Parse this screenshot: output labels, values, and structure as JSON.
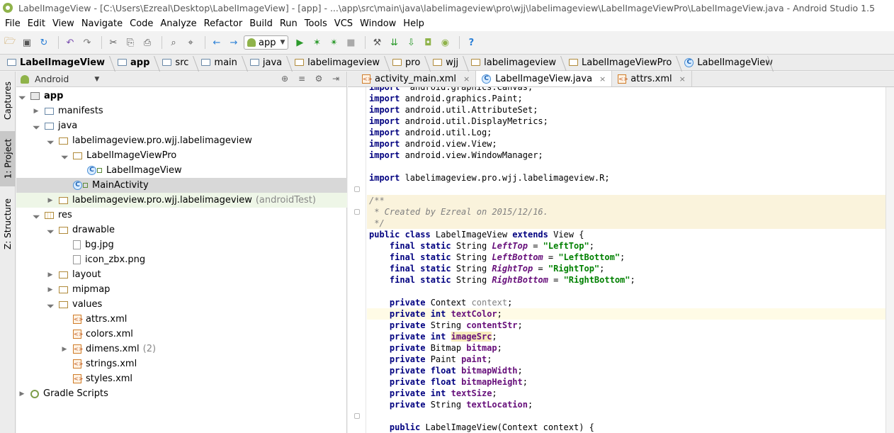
{
  "window": {
    "title": "LabelImageView - [C:\\Users\\Ezreal\\Desktop\\LabelImageView] - [app] - ...\\app\\src\\main\\java\\labelimageview\\pro\\wjj\\labelimageview\\LabelImageViewPro\\LabelImageView.java - Android Studio 1.5"
  },
  "menu": [
    "File",
    "Edit",
    "View",
    "Navigate",
    "Code",
    "Analyze",
    "Refactor",
    "Build",
    "Run",
    "Tools",
    "VCS",
    "Window",
    "Help"
  ],
  "toolbar": {
    "run_config": "app",
    "icons": [
      "open-icon",
      "save-icon",
      "sync-icon",
      "undo-icon",
      "redo-icon",
      "cut-icon",
      "copy-icon",
      "paste-icon",
      "find-icon",
      "replace-icon",
      "back-icon",
      "forward-icon",
      "run-icon",
      "debug-icon",
      "attach-icon",
      "stop-icon",
      "sdk-icon",
      "sync-gradle-icon",
      "avd-icon",
      "monitor-icon",
      "help-icon"
    ]
  },
  "breadcrumb": [
    "LabelImageView",
    "app",
    "src",
    "main",
    "java",
    "labelimageview",
    "pro",
    "wjj",
    "labelimageview",
    "LabelImageViewPro",
    "LabelImageView"
  ],
  "left_strip": {
    "captures": "Captures",
    "project": "1: Project",
    "structure": "Z: Structure"
  },
  "project_panel": {
    "view_selector": "Android",
    "tree": [
      {
        "label": "app",
        "extra": "",
        "depth": 0,
        "expanded": true,
        "icon": "module-icon",
        "bold": true
      },
      {
        "label": "manifests",
        "extra": "",
        "depth": 1,
        "expanded": false,
        "icon": "folder-icon"
      },
      {
        "label": "java",
        "extra": "",
        "depth": 1,
        "expanded": true,
        "icon": "folder-icon"
      },
      {
        "label": "labelimageview.pro.wjj.labelimageview",
        "extra": "",
        "depth": 2,
        "expanded": true,
        "icon": "package-icon"
      },
      {
        "label": "LabelImageViewPro",
        "extra": "",
        "depth": 3,
        "expanded": true,
        "icon": "package-icon"
      },
      {
        "label": "LabelImageView",
        "extra": "",
        "depth": 4,
        "expanded": null,
        "icon": "class-icon"
      },
      {
        "label": "MainActivity",
        "extra": "",
        "depth": 3,
        "expanded": null,
        "icon": "class-icon",
        "selected": true
      },
      {
        "label": "labelimageview.pro.wjj.labelimageview",
        "extra": "(androidTest)",
        "depth": 2,
        "expanded": false,
        "icon": "package-icon",
        "tinted": true
      },
      {
        "label": "res",
        "extra": "",
        "depth": 1,
        "expanded": true,
        "icon": "res-folder-icon"
      },
      {
        "label": "drawable",
        "extra": "",
        "depth": 2,
        "expanded": true,
        "icon": "package-icon"
      },
      {
        "label": "bg.jpg",
        "extra": "",
        "depth": 3,
        "expanded": null,
        "icon": "image-file-icon"
      },
      {
        "label": "icon_zbx.png",
        "extra": "",
        "depth": 3,
        "expanded": null,
        "icon": "image-file-icon"
      },
      {
        "label": "layout",
        "extra": "",
        "depth": 2,
        "expanded": false,
        "icon": "package-icon"
      },
      {
        "label": "mipmap",
        "extra": "",
        "depth": 2,
        "expanded": false,
        "icon": "package-icon"
      },
      {
        "label": "values",
        "extra": "",
        "depth": 2,
        "expanded": true,
        "icon": "package-icon"
      },
      {
        "label": "attrs.xml",
        "extra": "",
        "depth": 3,
        "expanded": null,
        "icon": "xml-file-icon"
      },
      {
        "label": "colors.xml",
        "extra": "",
        "depth": 3,
        "expanded": null,
        "icon": "xml-file-icon"
      },
      {
        "label": "dimens.xml",
        "extra": "(2)",
        "depth": 3,
        "expanded": false,
        "icon": "xml-file-icon"
      },
      {
        "label": "strings.xml",
        "extra": "",
        "depth": 3,
        "expanded": null,
        "icon": "xml-file-icon"
      },
      {
        "label": "styles.xml",
        "extra": "",
        "depth": 3,
        "expanded": null,
        "icon": "xml-file-icon"
      },
      {
        "label": "Gradle Scripts",
        "extra": "",
        "depth": 0,
        "expanded": false,
        "icon": "gradle-icon"
      }
    ]
  },
  "editor": {
    "tabs": [
      {
        "label": "activity_main.xml",
        "active": false
      },
      {
        "label": "LabelImageView.java",
        "active": true
      },
      {
        "label": "attrs.xml",
        "active": false
      }
    ],
    "lines": [
      {
        "segs": [
          [
            "kw",
            "import"
          ],
          [
            "",
            "  android.graphics.Canvas;"
          ]
        ],
        "clip": true
      },
      {
        "segs": [
          [
            "kw",
            "import"
          ],
          [
            "",
            " android.graphics.Paint;"
          ]
        ]
      },
      {
        "segs": [
          [
            "kw",
            "import"
          ],
          [
            "",
            " android.util.AttributeSet;"
          ]
        ]
      },
      {
        "segs": [
          [
            "kw",
            "import"
          ],
          [
            "",
            " android.util.DisplayMetrics;"
          ]
        ]
      },
      {
        "segs": [
          [
            "kw",
            "import"
          ],
          [
            "",
            " android.util.Log;"
          ]
        ]
      },
      {
        "segs": [
          [
            "kw",
            "import"
          ],
          [
            "",
            " android.view.View;"
          ]
        ]
      },
      {
        "segs": [
          [
            "kw",
            "import"
          ],
          [
            "",
            " android.view.WindowManager;"
          ]
        ]
      },
      {
        "segs": []
      },
      {
        "segs": [
          [
            "kw",
            "import"
          ],
          [
            "",
            " labelimageview.pro.wjj.labelimageview.R;"
          ]
        ]
      },
      {
        "segs": []
      },
      {
        "segs": [
          [
            "cm",
            "/**"
          ]
        ],
        "doc": true
      },
      {
        "segs": [
          [
            "cm",
            " * Created by Ezreal on 2015/12/16."
          ]
        ],
        "doc": true
      },
      {
        "segs": [
          [
            "cm",
            " */"
          ]
        ],
        "doc": true
      },
      {
        "segs": [
          [
            "kw",
            "public class"
          ],
          [
            "",
            " LabelImageView "
          ],
          [
            "kw",
            "extends"
          ],
          [
            "",
            " View {"
          ]
        ]
      },
      {
        "segs": [
          [
            "",
            "    "
          ],
          [
            "kw",
            "final static"
          ],
          [
            "",
            " String "
          ],
          [
            "fldi",
            "LeftTop"
          ],
          [
            "",
            " = "
          ],
          [
            "str",
            "\"LeftTop\""
          ],
          [
            "",
            ";"
          ]
        ]
      },
      {
        "segs": [
          [
            "",
            "    "
          ],
          [
            "kw",
            "final static"
          ],
          [
            "",
            " String "
          ],
          [
            "fldi",
            "LeftBottom"
          ],
          [
            "",
            " = "
          ],
          [
            "str",
            "\"LeftBottom\""
          ],
          [
            "",
            ";"
          ]
        ]
      },
      {
        "segs": [
          [
            "",
            "    "
          ],
          [
            "kw",
            "final static"
          ],
          [
            "",
            " String "
          ],
          [
            "fldi",
            "RightTop"
          ],
          [
            "",
            " = "
          ],
          [
            "str",
            "\"RightTop\""
          ],
          [
            "",
            ";"
          ]
        ]
      },
      {
        "segs": [
          [
            "",
            "    "
          ],
          [
            "kw",
            "final static"
          ],
          [
            "",
            " String "
          ],
          [
            "fldi",
            "RightBottom"
          ],
          [
            "",
            " = "
          ],
          [
            "str",
            "\"RightBottom\""
          ],
          [
            "",
            ";"
          ]
        ]
      },
      {
        "segs": []
      },
      {
        "segs": [
          [
            "",
            "    "
          ],
          [
            "kw",
            "private"
          ],
          [
            "",
            " Context "
          ],
          [
            "pn",
            "context"
          ],
          [
            "",
            ";"
          ]
        ]
      },
      {
        "segs": [
          [
            "",
            "    "
          ],
          [
            "kw",
            "private int"
          ],
          [
            "",
            " "
          ],
          [
            "fld",
            "textColor"
          ],
          [
            "",
            ";"
          ]
        ],
        "cur": true
      },
      {
        "segs": [
          [
            "",
            "    "
          ],
          [
            "kw",
            "private"
          ],
          [
            "",
            " String "
          ],
          [
            "fld",
            "contentStr"
          ],
          [
            "",
            ";"
          ]
        ]
      },
      {
        "segs": [
          [
            "",
            "    "
          ],
          [
            "kw",
            "private int"
          ],
          [
            "",
            " "
          ],
          [
            "fld warn",
            "imageSrc"
          ],
          [
            "",
            ";"
          ]
        ]
      },
      {
        "segs": [
          [
            "",
            "    "
          ],
          [
            "kw",
            "private"
          ],
          [
            "",
            " Bitmap "
          ],
          [
            "fld",
            "bitmap"
          ],
          [
            "",
            ";"
          ]
        ]
      },
      {
        "segs": [
          [
            "",
            "    "
          ],
          [
            "kw",
            "private"
          ],
          [
            "",
            " Paint "
          ],
          [
            "fld",
            "paint"
          ],
          [
            "",
            ";"
          ]
        ]
      },
      {
        "segs": [
          [
            "",
            "    "
          ],
          [
            "kw",
            "private float"
          ],
          [
            "",
            " "
          ],
          [
            "fld",
            "bitmapWidth"
          ],
          [
            "",
            ";"
          ]
        ]
      },
      {
        "segs": [
          [
            "",
            "    "
          ],
          [
            "kw",
            "private float"
          ],
          [
            "",
            " "
          ],
          [
            "fld",
            "bitmapHeight"
          ],
          [
            "",
            ";"
          ]
        ]
      },
      {
        "segs": [
          [
            "",
            "    "
          ],
          [
            "kw",
            "private int"
          ],
          [
            "",
            " "
          ],
          [
            "fld",
            "textSize"
          ],
          [
            "",
            ";"
          ]
        ]
      },
      {
        "segs": [
          [
            "",
            "    "
          ],
          [
            "kw",
            "private"
          ],
          [
            "",
            " String "
          ],
          [
            "fld",
            "textLocation"
          ],
          [
            "",
            ";"
          ]
        ]
      },
      {
        "segs": []
      },
      {
        "segs": [
          [
            "",
            "    "
          ],
          [
            "kw",
            "public"
          ],
          [
            "",
            " LabelImageView(Context context) {"
          ]
        ]
      }
    ]
  }
}
